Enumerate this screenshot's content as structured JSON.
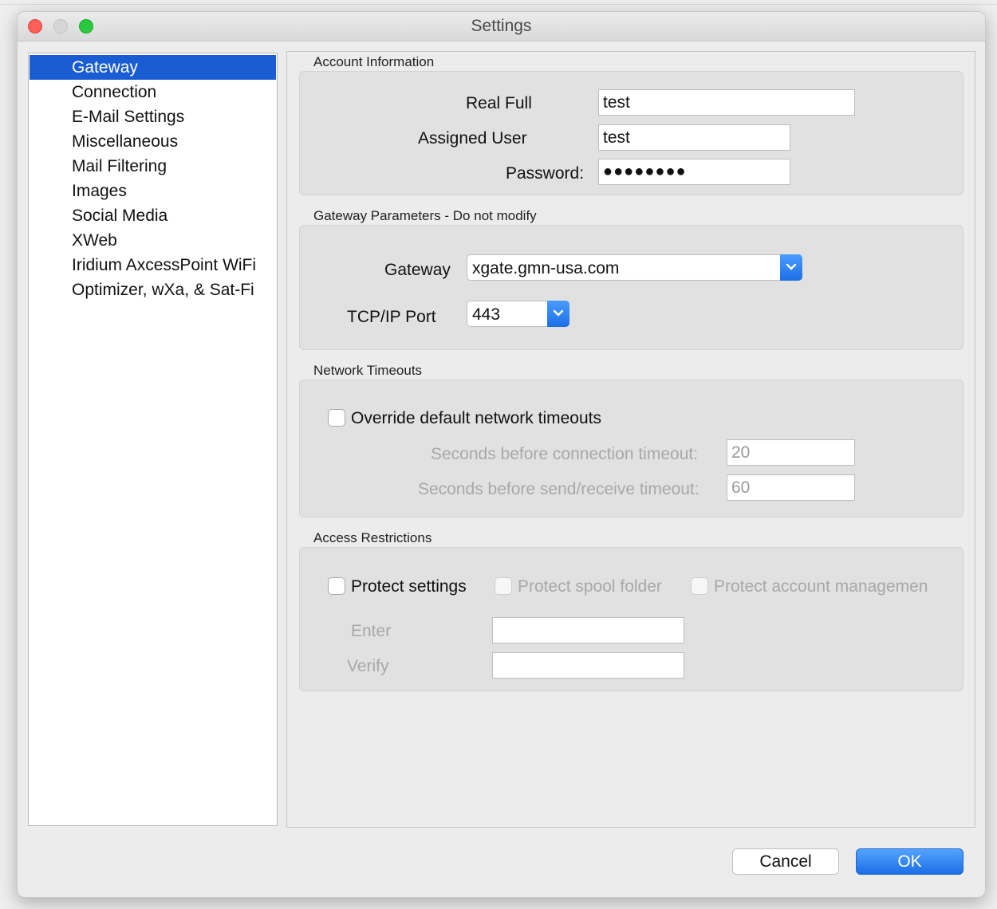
{
  "window": {
    "title": "Settings"
  },
  "sidebar": {
    "items": [
      {
        "label": "Gateway",
        "selected": true
      },
      {
        "label": "Connection"
      },
      {
        "label": "E-Mail Settings"
      },
      {
        "label": "Miscellaneous"
      },
      {
        "label": "Mail Filtering"
      },
      {
        "label": "Images"
      },
      {
        "label": "Social Media"
      },
      {
        "label": "XWeb"
      },
      {
        "label": "Iridium AxcessPoint WiFi"
      },
      {
        "label": "Optimizer, wXa, & Sat-Fi"
      }
    ]
  },
  "account": {
    "heading": "Account Information",
    "real_full_label": "Real Full",
    "real_full_value": "test",
    "assigned_user_label": "Assigned User",
    "assigned_user_value": "test",
    "password_label": "Password:",
    "password_value": "●●●●●●●●"
  },
  "gateway_params": {
    "heading": "Gateway Parameters - Do not modify",
    "gateway_label": "Gateway",
    "gateway_value": "xgate.gmn-usa.com",
    "port_label": "TCP/IP Port",
    "port_value": "443"
  },
  "timeouts": {
    "heading": "Network Timeouts",
    "override_label": "Override default network timeouts",
    "override_checked": false,
    "connection_label": "Seconds before connection timeout:",
    "connection_value": "20",
    "sendrecv_label": "Seconds before send/receive timeout:",
    "sendrecv_value": "60"
  },
  "access": {
    "heading": "Access Restrictions",
    "protect_settings_label": "Protect settings",
    "protect_spool_label": "Protect spool folder",
    "protect_account_label": "Protect account managemen",
    "enter_label": "Enter",
    "verify_label": "Verify",
    "enter_value": "",
    "verify_value": ""
  },
  "buttons": {
    "cancel": "Cancel",
    "ok": "OK"
  },
  "colors": {
    "selection": "#1a5dd3",
    "accent": "#1c6fe6"
  }
}
